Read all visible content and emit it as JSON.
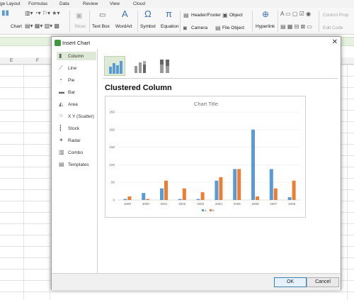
{
  "ribbon_tabs": [
    "ge Layout",
    "Formulas",
    "Data",
    "Review",
    "View",
    "Cloud"
  ],
  "ribbon": {
    "chart": "Chart",
    "slicer": "Slicer",
    "text_box": "Text Box",
    "wordart": "WordArt",
    "symbol": "Symbol",
    "equation": "Equation",
    "header_footer": "Header/Footer",
    "object": "Object",
    "camera": "Camera",
    "file_object": "File Object",
    "hyperlink": "Hyperlink",
    "control_prop": "Control Prop",
    "edit_code": "Edit Code"
  },
  "columns": [
    "E",
    "F"
  ],
  "dialog": {
    "title": "Insert Chart",
    "chart_types": [
      {
        "label": "Column",
        "icon": "column-chart-icon"
      },
      {
        "label": "Line",
        "icon": "line-chart-icon"
      },
      {
        "label": "Pie",
        "icon": "pie-chart-icon"
      },
      {
        "label": "Bar",
        "icon": "bar-chart-icon"
      },
      {
        "label": "Area",
        "icon": "area-chart-icon"
      },
      {
        "label": "X Y (Scatter)",
        "icon": "scatter-chart-icon"
      },
      {
        "label": "Stock",
        "icon": "stock-chart-icon"
      },
      {
        "label": "Radar",
        "icon": "radar-chart-icon"
      },
      {
        "label": "Combo",
        "icon": "combo-chart-icon"
      },
      {
        "label": "Templates",
        "icon": "templates-icon"
      }
    ],
    "selected_type": "Clustered Column",
    "ok": "OK",
    "cancel": "Cancel"
  },
  "chart_data": {
    "type": "bar",
    "title": "Chart Title",
    "categories": [
      "1999",
      "2000",
      "2001",
      "2002",
      "2003",
      "2004",
      "2005",
      "2006",
      "2007",
      "2008"
    ],
    "series": [
      {
        "name": "A",
        "color": "#5b9bd5",
        "values": [
          3,
          20,
          33,
          3,
          3,
          55,
          88,
          200,
          88,
          8
        ]
      },
      {
        "name": "B",
        "color": "#ed7d31",
        "values": [
          10,
          3,
          55,
          33,
          22,
          65,
          88,
          10,
          33,
          55
        ]
      }
    ],
    "yticks": [
      0,
      50,
      100,
      150,
      200,
      250
    ],
    "ylim": [
      0,
      250
    ],
    "legend": "bottom"
  }
}
